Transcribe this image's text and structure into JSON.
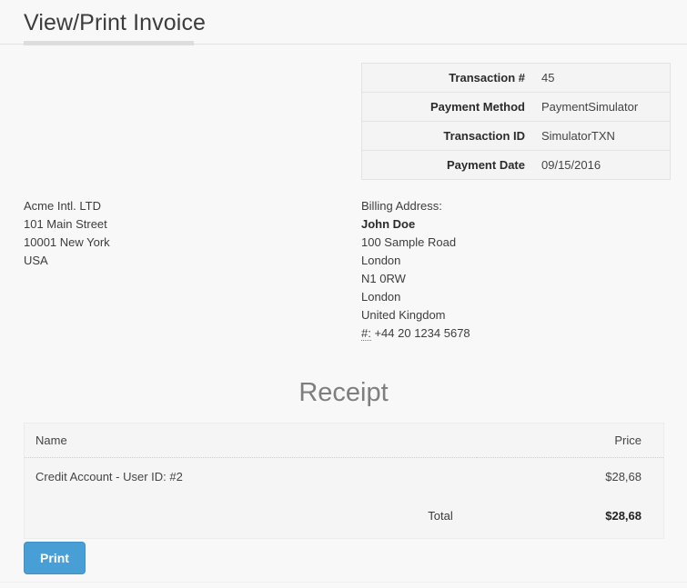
{
  "header": {
    "title": "View/Print Invoice"
  },
  "transaction": {
    "rows": [
      {
        "label": "Transaction #",
        "value": "45"
      },
      {
        "label": "Payment Method",
        "value": "PaymentSimulator"
      },
      {
        "label": "Transaction ID",
        "value": "SimulatorTXN"
      },
      {
        "label": "Payment Date",
        "value": "09/15/2016"
      }
    ]
  },
  "company_address": {
    "lines": [
      "Acme Intl. LTD",
      "101 Main Street",
      "10001 New York",
      "USA"
    ]
  },
  "billing_address": {
    "heading": "Billing Address:",
    "name": "John Doe",
    "lines": [
      "100 Sample Road",
      "London",
      "N1 0RW",
      "London",
      "United Kingdom"
    ],
    "phone_abbr": "#:",
    "phone": "+44 20 1234 5678"
  },
  "receipt": {
    "heading": "Receipt",
    "columns": {
      "name": "Name",
      "price": "Price"
    },
    "items": [
      {
        "name": "Credit Account - User ID: #2",
        "price": "$28,68"
      }
    ],
    "total_label": "Total",
    "total_value": "$28,68"
  },
  "actions": {
    "print_label": "Print"
  },
  "colors": {
    "accent": "#479fd6",
    "page_background": "#f8f8f8",
    "table_background": "#f4f4f4",
    "heading_grey": "#7e7e7e"
  }
}
